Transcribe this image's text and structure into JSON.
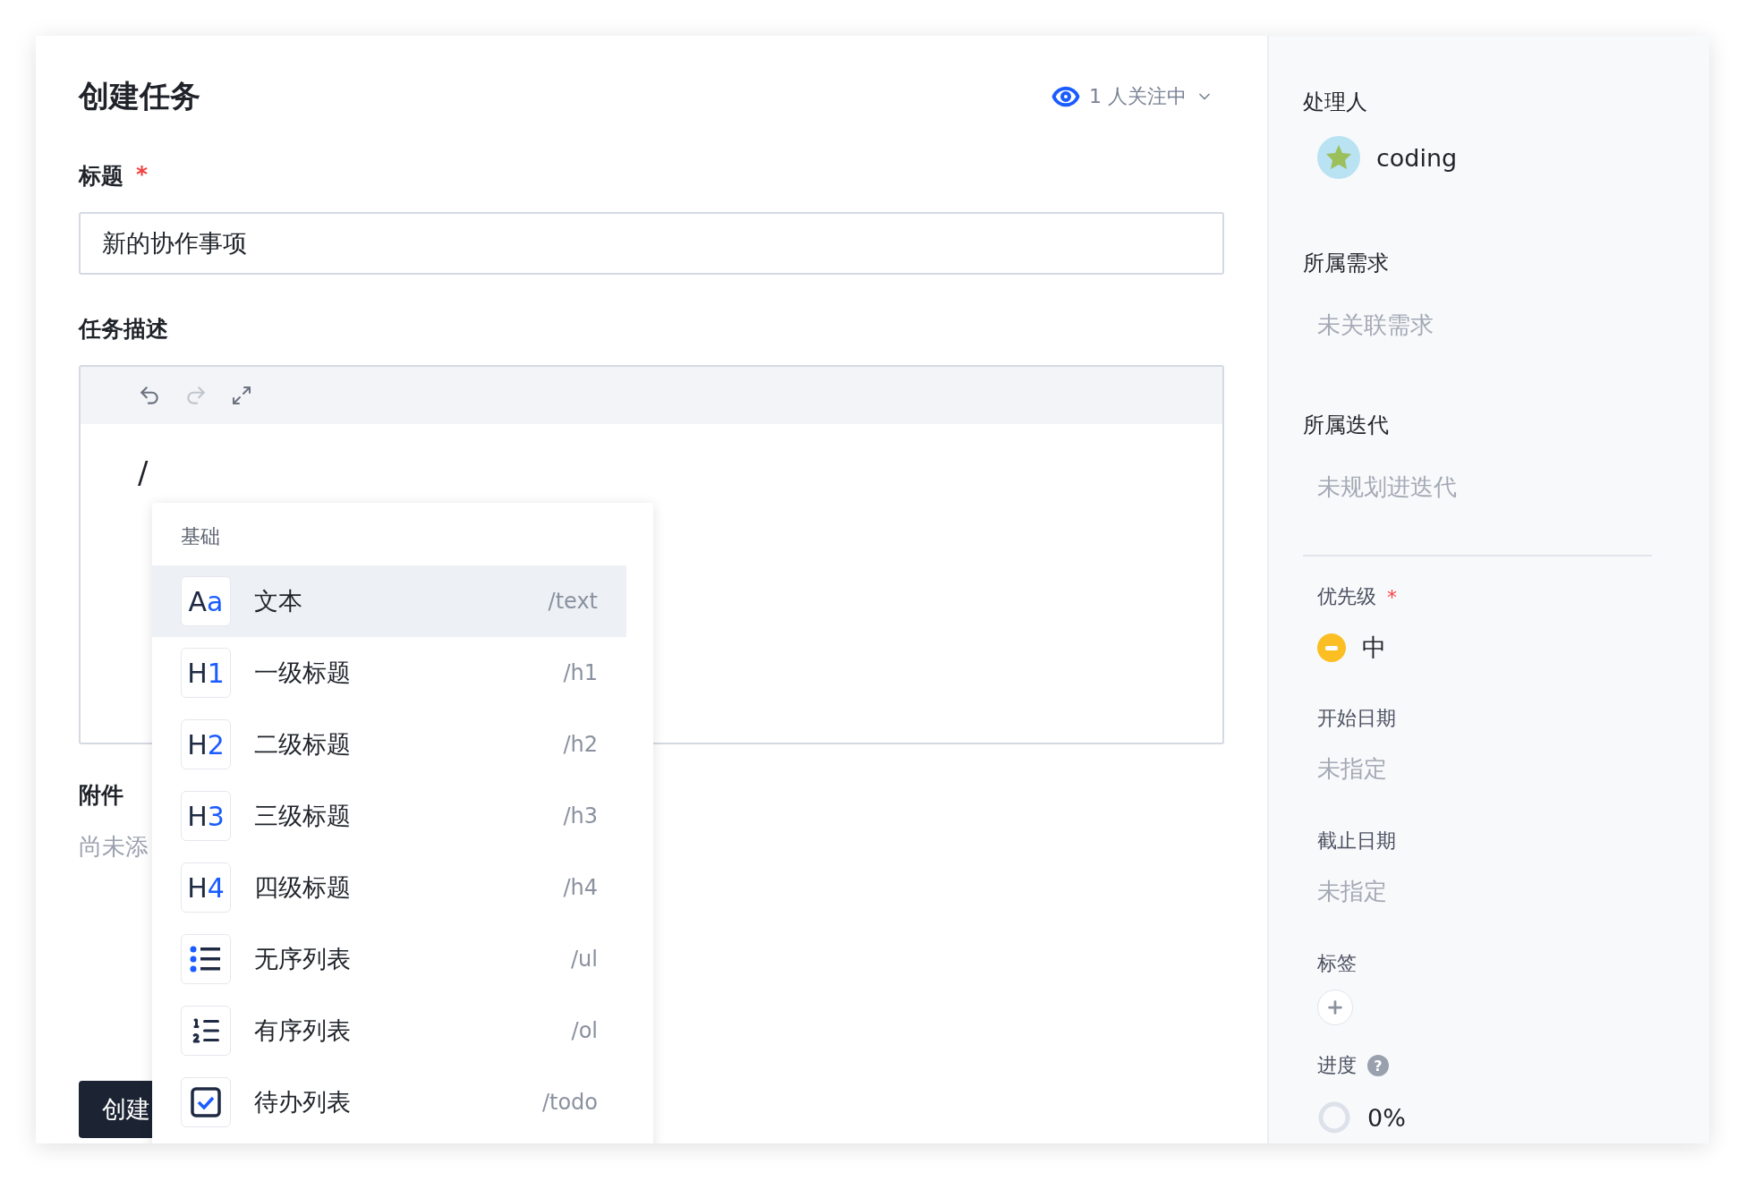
{
  "title": "创建任务",
  "watch": {
    "label": "1 人关注中"
  },
  "required_mark": "*",
  "fields": {
    "title_label": "标题",
    "title_required": true,
    "title_value": "新的协作事项",
    "desc_label": "任务描述",
    "attach_label": "附件",
    "attach_empty": "尚未添"
  },
  "toolbar": [
    {
      "kind": "undo",
      "disabled": false
    },
    {
      "kind": "redo",
      "disabled": true
    },
    {
      "kind": "expand",
      "disabled": false
    }
  ],
  "editor_text": "/",
  "slash_menu": {
    "group": "基础",
    "items": [
      {
        "kind": "glyph",
        "icon_main": "A",
        "icon_accent": "a",
        "label": "文本",
        "command": "/text",
        "selected": true
      },
      {
        "kind": "glyph",
        "icon_main": "H",
        "icon_accent": "1",
        "label": "一级标题",
        "command": "/h1",
        "selected": false
      },
      {
        "kind": "glyph",
        "icon_main": "H",
        "icon_accent": "2",
        "label": "二级标题",
        "command": "/h2",
        "selected": false
      },
      {
        "kind": "glyph",
        "icon_main": "H",
        "icon_accent": "3",
        "label": "三级标题",
        "command": "/h3",
        "selected": false
      },
      {
        "kind": "glyph",
        "icon_main": "H",
        "icon_accent": "4",
        "label": "四级标题",
        "command": "/h4",
        "selected": false
      },
      {
        "kind": "bullets",
        "label": "无序列表",
        "command": "/ul",
        "selected": false
      },
      {
        "kind": "numbers",
        "label": "有序列表",
        "command": "/ol",
        "selected": false
      },
      {
        "kind": "todo",
        "label": "待办列表",
        "command": "/todo",
        "selected": false
      }
    ]
  },
  "create_button": "创建",
  "sidebar": {
    "assignee": {
      "label": "处理人",
      "name": "coding"
    },
    "requirement": {
      "label": "所属需求",
      "value": "未关联需求"
    },
    "iteration": {
      "label": "所属迭代",
      "value": "未规划进迭代"
    },
    "priority": {
      "label": "优先级",
      "required": true,
      "value": "中",
      "color": "#fbbf24"
    },
    "start_date": {
      "label": "开始日期",
      "value": "未指定"
    },
    "due_date": {
      "label": "截止日期",
      "value": "未指定"
    },
    "tags": {
      "label": "标签"
    },
    "progress": {
      "label": "进度",
      "help": "?",
      "value": "0%",
      "level": 0
    }
  }
}
